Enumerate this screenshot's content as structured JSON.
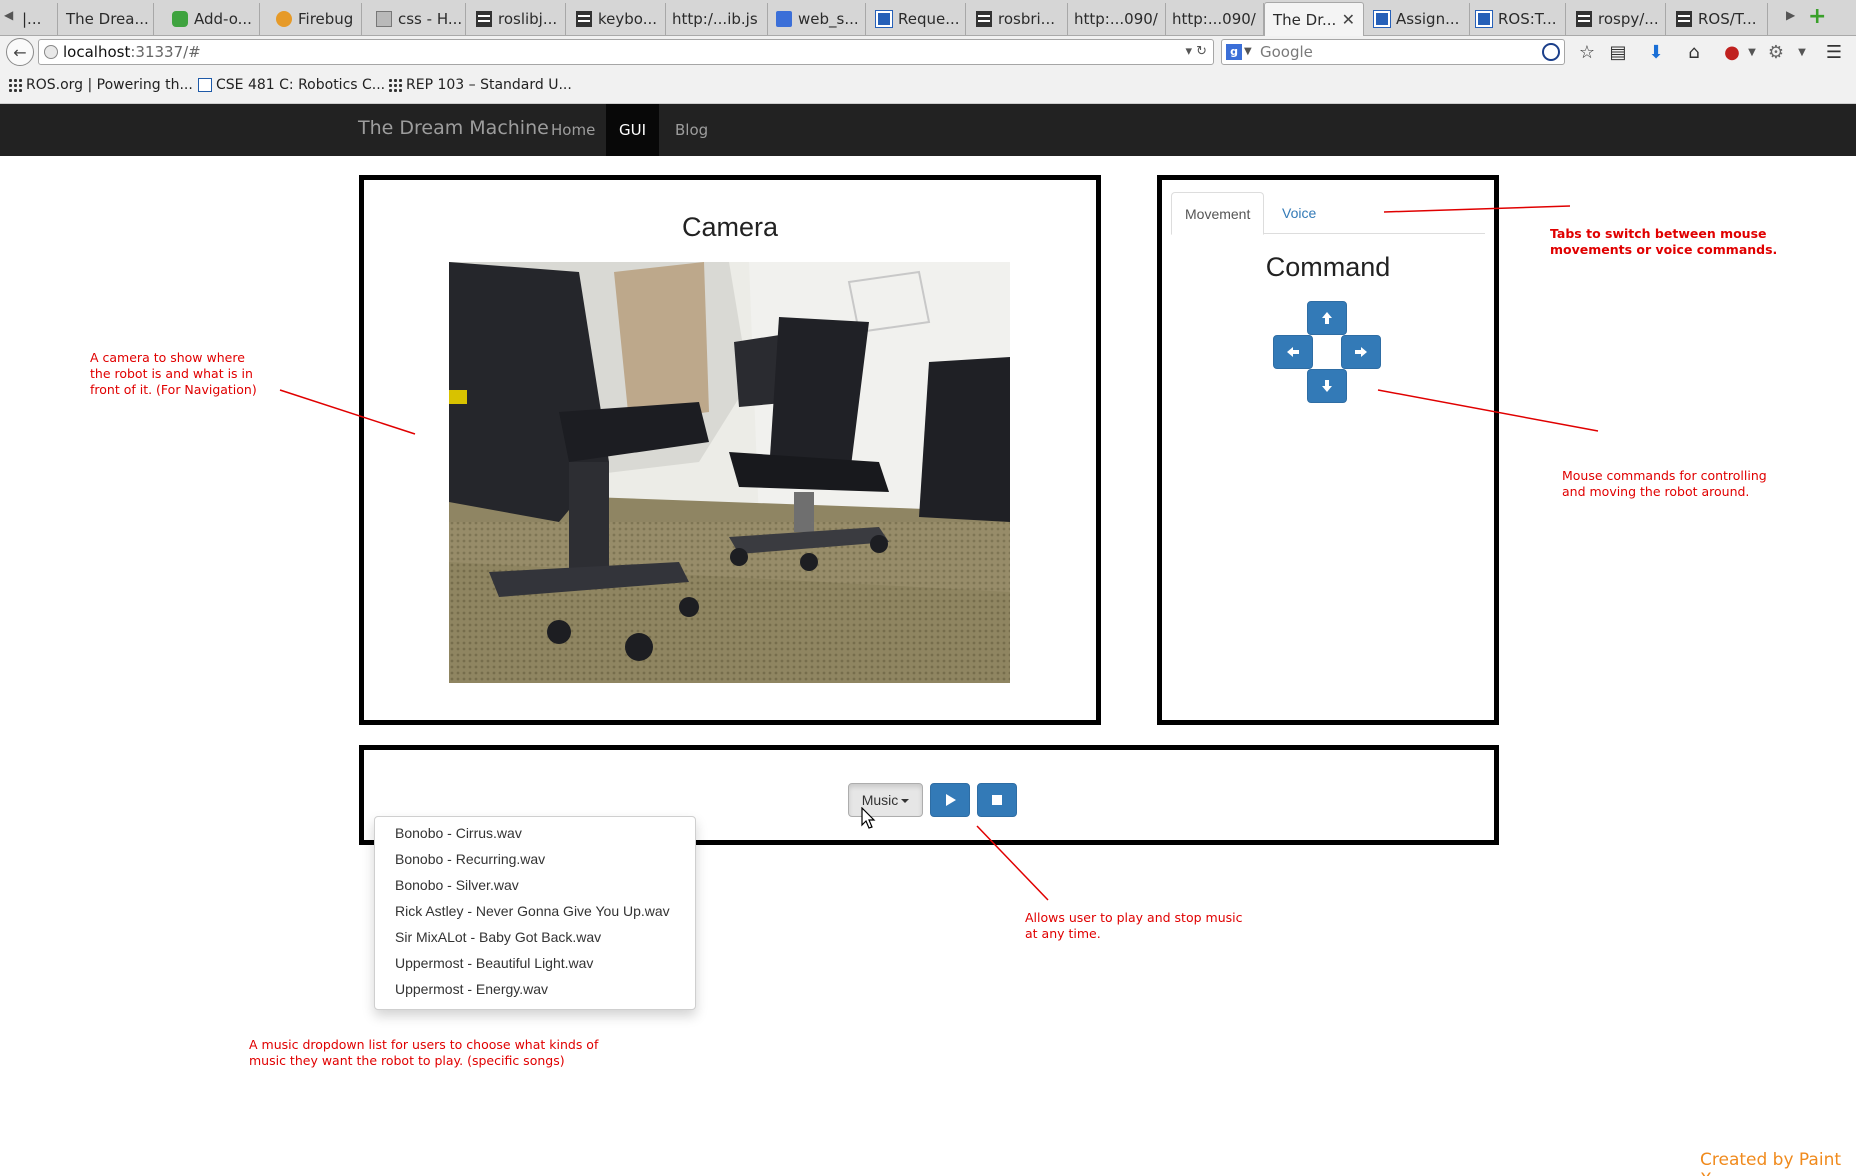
{
  "browser": {
    "tabs": [
      {
        "label": "|..."
      },
      {
        "label": "The Drea..."
      },
      {
        "label": "Add-o..."
      },
      {
        "label": "Firebug"
      },
      {
        "label": "css - H..."
      },
      {
        "label": "roslibj..."
      },
      {
        "label": "keybo..."
      },
      {
        "label": "http:/...ib.js"
      },
      {
        "label": "web_s..."
      },
      {
        "label": "Reque..."
      },
      {
        "label": "rosbri..."
      },
      {
        "label": "http:...090/"
      },
      {
        "label": "http:...090/"
      },
      {
        "label": "The Dr...",
        "active": true
      },
      {
        "label": "Assign..."
      },
      {
        "label": "ROS:T..."
      },
      {
        "label": "rospy/..."
      },
      {
        "label": "ROS/T..."
      }
    ],
    "url_host": "localhost",
    "url_rest": ":31337/#",
    "search_placeholder": "Google",
    "bookmarks": [
      {
        "label": "ROS.org | Powering th..."
      },
      {
        "label": "CSE 481 C: Robotics C..."
      },
      {
        "label": "REP 103 – Standard U..."
      }
    ]
  },
  "site": {
    "brand": "The Dream Machine",
    "nav": [
      {
        "label": "Home",
        "active": false
      },
      {
        "label": "GUI",
        "active": true
      },
      {
        "label": "Blog",
        "active": false
      }
    ]
  },
  "camera": {
    "title": "Camera"
  },
  "command": {
    "tabs": [
      {
        "label": "Movement",
        "active": true
      },
      {
        "label": "Voice",
        "active": false
      }
    ],
    "title": "Command",
    "buttons": [
      "arrow-up",
      "arrow-left",
      "arrow-right",
      "arrow-down"
    ]
  },
  "music": {
    "dropdown_label": "Music",
    "play_icon": "play-icon",
    "stop_icon": "stop-icon",
    "songs": [
      "Bonobo - Cirrus.wav",
      "Bonobo - Recurring.wav",
      "Bonobo - Silver.wav",
      "Rick Astley - Never Gonna Give You Up.wav",
      "Sir MixALot - Baby Got Back.wav",
      "Uppermost - Beautiful Light.wav",
      "Uppermost - Energy.wav"
    ]
  },
  "annotations": {
    "camera_note": [
      "A camera to show where",
      "the robot is and what is in",
      "front of it. (For Navigation)"
    ],
    "tabs_note": [
      "Tabs to switch between mouse",
      "movements or voice commands."
    ],
    "mouse_note": [
      "Mouse commands for controlling",
      "and moving the robot around."
    ],
    "play_note": [
      "Allows user to play and stop music",
      "at any time."
    ],
    "dropdown_note": [
      "A music dropdown list for users to choose what kinds of",
      "music they want the robot to play. (specific songs)"
    ],
    "color": "#e00000"
  },
  "credit": "Created by Paint X",
  "colors": {
    "navbar_bg": "#222222",
    "primary_button": "#337ab7",
    "credit": "#f08a1c"
  }
}
